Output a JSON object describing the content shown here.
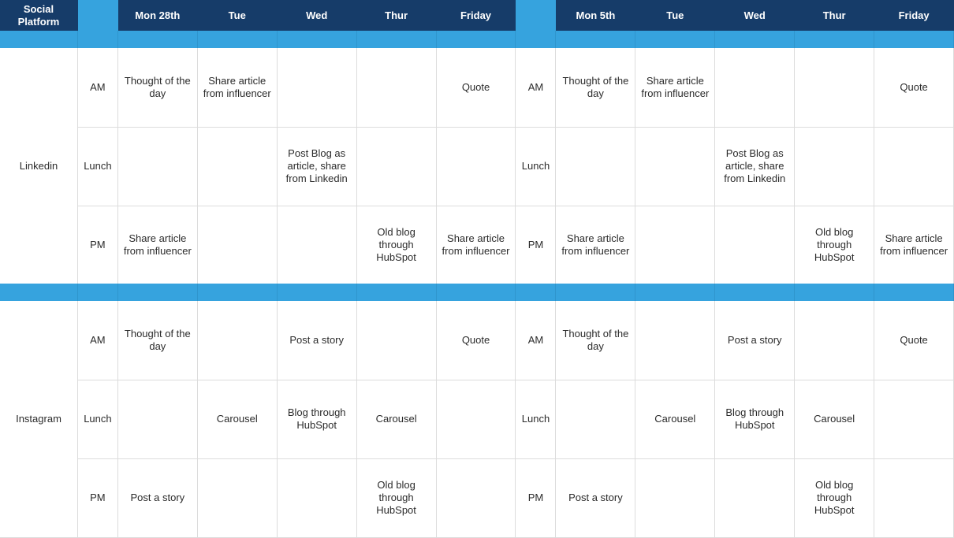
{
  "header": {
    "platform_label": "Social Platform",
    "week1": [
      "Mon 28th",
      "Tue",
      "Wed",
      "Thur",
      "Friday"
    ],
    "week2": [
      "Mon 5th",
      "Tue",
      "Wed",
      "Thur",
      "Friday"
    ]
  },
  "colors": {
    "header_bg": "#163c69",
    "band": "#36a3de",
    "grid_line": "#dcdcdc"
  },
  "platforms": [
    {
      "name": "Linkedin",
      "rows": [
        {
          "time": "AM",
          "week1": [
            "Thought of the day",
            "Share article from influencer",
            "",
            "",
            "Quote"
          ],
          "week2": [
            "Thought of the day",
            "Share article from influencer",
            "",
            "",
            "Quote"
          ]
        },
        {
          "time": "Lunch",
          "week1": [
            "",
            "",
            "Post Blog as article, share from Linkedin",
            "",
            ""
          ],
          "week2": [
            "",
            "",
            "Post Blog as article, share from Linkedin",
            "",
            ""
          ]
        },
        {
          "time": "PM",
          "week1": [
            "Share article from influencer",
            "",
            "",
            "Old blog through HubSpot",
            "Share article from influencer"
          ],
          "week2": [
            "Share article from influencer",
            "",
            "",
            "Old blog through HubSpot",
            "Share article from influencer"
          ]
        }
      ]
    },
    {
      "name": "Instagram",
      "rows": [
        {
          "time": "AM",
          "week1": [
            "Thought of the day",
            "",
            "Post a story",
            "",
            "Quote"
          ],
          "week2": [
            "Thought of the day",
            "",
            "Post a story",
            "",
            "Quote"
          ]
        },
        {
          "time": "Lunch",
          "week1": [
            "",
            "Carousel",
            "Blog through HubSpot",
            "Carousel",
            ""
          ],
          "week2": [
            "",
            "Carousel",
            "Blog through HubSpot",
            "Carousel",
            ""
          ]
        },
        {
          "time": "PM",
          "week1": [
            "Post a story",
            "",
            "",
            "Old blog through HubSpot",
            ""
          ],
          "week2": [
            "Post a story",
            "",
            "",
            "Old blog through HubSpot",
            ""
          ]
        }
      ]
    }
  ]
}
